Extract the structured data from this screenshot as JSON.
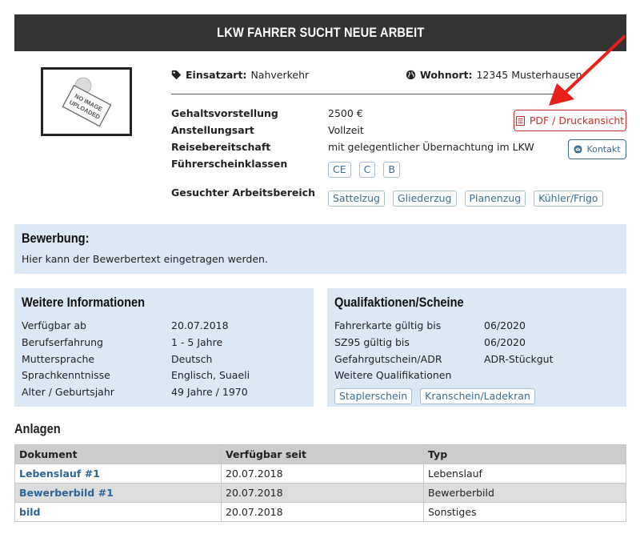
{
  "header": {
    "title": "LKW FAHRER SUCHT NEUE ARBEIT"
  },
  "photo": {
    "placeholder_text": "NO IMAGE UPLOADED"
  },
  "meta": {
    "einsatzart_label": "Einsatzart:",
    "einsatzart_value": "Nahverkehr",
    "wohnort_label": "Wohnort:",
    "wohnort_value": "12345 Musterhausen"
  },
  "facts": [
    {
      "label": "Gehaltsvorstellung",
      "value": "2500 €"
    },
    {
      "label": "Anstellungsart",
      "value": "Vollzeit"
    },
    {
      "label": "Reisebereitschaft",
      "value": "mit gelegentlicher Übernachtung im LKW"
    },
    {
      "label": "Führerscheinklassen",
      "value": ""
    },
    {
      "label": "Gesuchter Arbeitsbereich",
      "value": ""
    }
  ],
  "license_classes": [
    "CE",
    "C",
    "B"
  ],
  "work_areas": [
    "Sattelzug",
    "Gliederzug",
    "Planenzug",
    "Kühler/Frigo"
  ],
  "buttons": {
    "pdf_label": "PDF / Druckansicht",
    "contact_label": "Kontakt"
  },
  "bewerbung": {
    "title": "Bewerbung:",
    "text": "Hier kann der Bewerbertext eingetragen werden."
  },
  "weitere": {
    "title": "Weitere Informationen",
    "rows": [
      {
        "key": "Verfügbar ab",
        "value": "20.07.2018"
      },
      {
        "key": "Berufserfahrung",
        "value": "1 - 5 Jahre"
      },
      {
        "key": "Muttersprache",
        "value": "Deutsch"
      },
      {
        "key": "Sprachkenntnisse",
        "value": "Englisch, Suaeli"
      },
      {
        "key": "Alter / Geburtsjahr",
        "value": "49 Jahre / 1970"
      }
    ]
  },
  "quali": {
    "title": "Qualifaktionen/Scheine",
    "rows": [
      {
        "key": "Fahrerkarte gültig bis",
        "value": "06/2020"
      },
      {
        "key": "SZ95 gültig bis",
        "value": "06/2020"
      },
      {
        "key": "Gefahrgutschein/ADR",
        "value": "ADR-Stückgut"
      },
      {
        "key": "Weitere Qualifikationen",
        "value": ""
      }
    ],
    "tags": [
      "Staplerschein",
      "Kranschein/Ladekran"
    ]
  },
  "anlagen": {
    "title": "Anlagen",
    "columns": [
      "Dokument",
      "Verfügbar seit",
      "Typ"
    ],
    "rows": [
      {
        "doc": "Lebenslauf #1",
        "date": "20.07.2018",
        "type": "Lebenslauf"
      },
      {
        "doc": "Bewerberbild #1",
        "date": "20.07.2018",
        "type": "Bewerberbild"
      },
      {
        "doc": "bild",
        "date": "20.07.2018",
        "type": "Sonstiges"
      }
    ]
  },
  "colors": {
    "header_bg": "#333333",
    "panel_bg": "#dce9f5",
    "pdf_red": "#c9302c",
    "link_blue": "#2f6496",
    "arrow_red": "#e8201a"
  },
  "icons": {
    "einsatzart": "tag-icon",
    "wohnort": "globe-icon",
    "pdf": "document-icon",
    "contact": "envelope-icon"
  }
}
